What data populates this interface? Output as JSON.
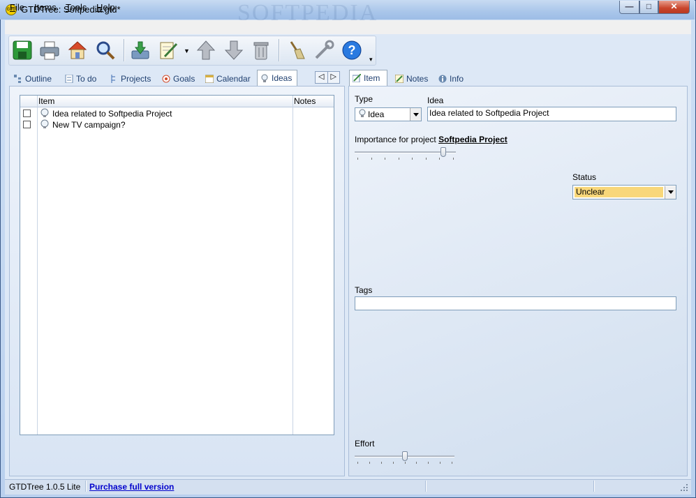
{
  "window": {
    "title": "GTDTree: Softpedia.gtd*",
    "app_icon_text": "GTD",
    "watermark": "SOFTPEDIA",
    "controls": {
      "minimize": "—",
      "maximize": "□",
      "close": "✕"
    }
  },
  "menu": [
    {
      "label": "File",
      "accel": "F"
    },
    {
      "label": "Items",
      "accel": "I"
    },
    {
      "label": "Tools",
      "accel": "T"
    },
    {
      "label": "Help",
      "accel": "H"
    }
  ],
  "toolbar": {
    "icons": [
      "save-icon",
      "print-icon",
      "home-icon",
      "search-icon",
      "import-icon",
      "edit-icon",
      "up-arrow-icon",
      "down-arrow-icon",
      "trash-icon",
      "clean-icon",
      "tools-icon",
      "help-icon"
    ],
    "overflow": "▾"
  },
  "left_tabs": [
    {
      "label": "Outline",
      "icon": "outline-icon"
    },
    {
      "label": "To do",
      "icon": "todo-icon"
    },
    {
      "label": "Projects",
      "icon": "projects-icon"
    },
    {
      "label": "Goals",
      "icon": "goals-icon"
    },
    {
      "label": "Calendar",
      "icon": "calendar-icon"
    },
    {
      "label": "Ideas",
      "icon": "bulb-icon",
      "active": true
    }
  ],
  "nav_arrows": {
    "prev": "◁",
    "next": "▷"
  },
  "right_tabs": [
    {
      "label": "Item",
      "icon": "item-icon",
      "active": true
    },
    {
      "label": "Notes",
      "icon": "notes-icon"
    },
    {
      "label": "Info",
      "icon": "info-icon"
    }
  ],
  "grid": {
    "columns": [
      "Item",
      "Notes"
    ],
    "rows": [
      {
        "checked": false,
        "item": "Idea related to Softpedia Project",
        "notes": ""
      },
      {
        "checked": false,
        "item": "New TV campaign?",
        "notes": ""
      }
    ]
  },
  "detail": {
    "type_label": "Type",
    "type_value": "Idea",
    "idea_label": "Idea",
    "idea_value": "Idea related to Softpedia Project",
    "importance_label": "Importance  for project",
    "project_name": "Softpedia Project",
    "importance_level": 0.9,
    "status_label": "Status",
    "status_value": "Unclear",
    "tags_label": "Tags",
    "tags_value": "",
    "effort_label": "Effort",
    "effort_level": 0.5
  },
  "statusbar": {
    "version": "GTDTree 1.0.5 Lite",
    "purchase_link": "Purchase full version"
  },
  "colors": {
    "status_highlight": "#f8d77a",
    "accent": "#1f3f6f",
    "link": "#0000cc"
  }
}
